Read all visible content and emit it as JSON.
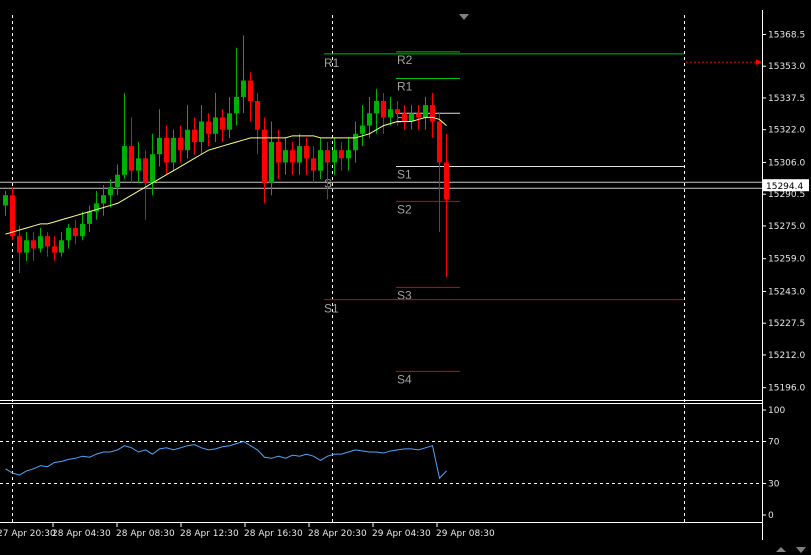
{
  "chart_data": [
    {
      "type": "candlestick",
      "ylim": [
        15190,
        15378
      ],
      "y_ticks": [
        15368.5,
        15353.0,
        15337.5,
        15322.0,
        15306.0,
        15290.5,
        15275.0,
        15259.0,
        15243.0,
        15227.5,
        15212.0,
        15196.0
      ],
      "y_tick_labels": [
        "15368.5",
        "15353.0",
        "15337.5",
        "15322.0",
        "15306.0",
        "15290.5",
        "15275.0",
        "15259.0",
        "15243.0",
        "15227.5",
        "15212.0",
        "15196.0"
      ],
      "current_price_label": "15294.4",
      "current_price": 15294.4,
      "x_tick_labels": [
        "27 Apr 20:30",
        "28 Apr 04:30",
        "28 Apr 08:30",
        "28 Apr 12:30",
        "28 Apr 16:30",
        "28 Apr 20:30",
        "29 Apr 04:30",
        "29 Apr 08:30"
      ],
      "candles": [
        [
          15285,
          15290,
          15280,
          15292
        ],
        [
          15290,
          15270,
          15268,
          15294
        ],
        [
          15270,
          15262,
          15252,
          15275
        ],
        [
          15262,
          15268,
          15258,
          15272
        ],
        [
          15268,
          15264,
          15258,
          15272
        ],
        [
          15264,
          15270,
          15262,
          15274
        ],
        [
          15270,
          15265,
          15260,
          15272
        ],
        [
          15265,
          15262,
          15258,
          15270
        ],
        [
          15262,
          15268,
          15260,
          15272
        ],
        [
          15268,
          15274,
          15264,
          15276
        ],
        [
          15274,
          15270,
          15266,
          15278
        ],
        [
          15270,
          15276,
          15268,
          15282
        ],
        [
          15276,
          15282,
          15272,
          15285
        ],
        [
          15282,
          15286,
          15278,
          15292
        ],
        [
          15286,
          15290,
          15280,
          15295
        ],
        [
          15290,
          15294,
          15284,
          15298
        ],
        [
          15294,
          15300,
          15290,
          15305
        ],
        [
          15300,
          15314,
          15298,
          15340
        ],
        [
          15314,
          15302,
          15296,
          15328
        ],
        [
          15302,
          15308,
          15296,
          15316
        ],
        [
          15308,
          15296,
          15278,
          15312
        ],
        [
          15296,
          15310,
          15290,
          15320
        ],
        [
          15310,
          15318,
          15304,
          15332
        ],
        [
          15318,
          15306,
          15300,
          15324
        ],
        [
          15306,
          15318,
          15302,
          15322
        ],
        [
          15318,
          15312,
          15306,
          15324
        ],
        [
          15312,
          15322,
          15308,
          15334
        ],
        [
          15322,
          15316,
          15310,
          15328
        ],
        [
          15316,
          15326,
          15310,
          15334
        ],
        [
          15326,
          15320,
          15314,
          15330
        ],
        [
          15320,
          15328,
          15316,
          15340
        ],
        [
          15328,
          15322,
          15316,
          15332
        ],
        [
          15322,
          15330,
          15318,
          15338
        ],
        [
          15330,
          15338,
          15324,
          15362
        ],
        [
          15338,
          15346,
          15330,
          15368
        ],
        [
          15346,
          15336,
          15326,
          15350
        ],
        [
          15336,
          15322,
          15310,
          15340
        ],
        [
          15322,
          15296,
          15286,
          15328
        ],
        [
          15296,
          15316,
          15290,
          15326
        ],
        [
          15316,
          15306,
          15298,
          15322
        ],
        [
          15306,
          15312,
          15300,
          15318
        ],
        [
          15312,
          15306,
          15300,
          15316
        ],
        [
          15306,
          15314,
          15300,
          15320
        ],
        [
          15314,
          15308,
          15300,
          15318
        ],
        [
          15308,
          15302,
          15296,
          15314
        ],
        [
          15302,
          15312,
          15298,
          15318
        ],
        [
          15312,
          15306,
          15288,
          15316
        ],
        [
          15306,
          15312,
          15300,
          15318
        ],
        [
          15312,
          15308,
          15302,
          15316
        ],
        [
          15308,
          15312,
          15302,
          15318
        ],
        [
          15312,
          15320,
          15306,
          15326
        ],
        [
          15320,
          15324,
          15314,
          15334
        ],
        [
          15324,
          15330,
          15318,
          15338
        ],
        [
          15330,
          15336,
          15320,
          15342
        ],
        [
          15336,
          15328,
          15320,
          15340
        ],
        [
          15328,
          15332,
          15324,
          15338
        ],
        [
          15332,
          15330,
          15324,
          15336
        ],
        [
          15330,
          15326,
          15322,
          15334
        ],
        [
          15326,
          15330,
          15322,
          15334
        ],
        [
          15330,
          15328,
          15322,
          15334
        ],
        [
          15328,
          15334,
          15322,
          15338
        ],
        [
          15334,
          15326,
          15318,
          15340
        ],
        [
          15326,
          15306,
          15272,
          15330
        ],
        [
          15306,
          15288,
          15250,
          15320
        ]
      ],
      "moving_average": [
        15271,
        15272,
        15273,
        15274,
        15275,
        15276,
        15276,
        15277,
        15278,
        15279,
        15280,
        15281,
        15282,
        15283,
        15284,
        15285,
        15286,
        15288,
        15290,
        15292,
        15294,
        15296,
        15298,
        15300,
        15302,
        15304,
        15306,
        15308,
        15310,
        15312,
        15313,
        15314,
        15315,
        15316,
        15317,
        15318,
        15318,
        15318,
        15318,
        15318,
        15318,
        15319,
        15319,
        15319,
        15319,
        15318,
        15318,
        15318,
        15318,
        15318,
        15318,
        15319,
        15320,
        15322,
        15324,
        15325,
        15326,
        15326,
        15326,
        15327,
        15328,
        15328,
        15327,
        15324
      ],
      "pivot_levels": [
        {
          "label": "R2",
          "value": 15360,
          "color": "#00c000"
        },
        {
          "label": "R1",
          "value": 15347,
          "color": "#00c000"
        },
        {
          "label": "P",
          "value": 15330,
          "color": "#e0e0e0"
        },
        {
          "label": "S1",
          "value": 15304,
          "color": "#e0e0e0"
        },
        {
          "label": "S2",
          "value": 15287,
          "color": "#e00000"
        },
        {
          "label": "S3",
          "value": 15245,
          "color": "#e00000"
        },
        {
          "label": "S4",
          "value": 15204,
          "color": "#e00000"
        },
        {
          "label": "R1",
          "value": 15359,
          "color": "#00c000"
        },
        {
          "label": "S1",
          "value": 15239,
          "color": "#e00000"
        },
        {
          "label": "S",
          "value": 15300,
          "color": "#e0e0e0"
        }
      ],
      "colors": {
        "bull": "#00b000",
        "bear": "#ff0000",
        "ma": "#ffff88"
      }
    },
    {
      "type": "line",
      "ylim": [
        0,
        100
      ],
      "y_ticks": [
        100,
        70,
        30,
        0
      ],
      "y_tick_labels": [
        "100",
        "70",
        "30",
        "0"
      ],
      "levels": [
        70,
        30
      ],
      "values": [
        44,
        40,
        38,
        42,
        44,
        47,
        46,
        50,
        51,
        53,
        54,
        56,
        55,
        58,
        60,
        60,
        62,
        66,
        64,
        60,
        62,
        58,
        63,
        64,
        62,
        64,
        66,
        67,
        64,
        62,
        63,
        65,
        66,
        68,
        70,
        66,
        62,
        55,
        54,
        56,
        54,
        57,
        56,
        58,
        56,
        52,
        56,
        58,
        58,
        60,
        62,
        61,
        60,
        60,
        59,
        61,
        62,
        63,
        63,
        62,
        64,
        66,
        35,
        42
      ],
      "color": "#4da6ff"
    }
  ],
  "menu_indicator": "▼"
}
